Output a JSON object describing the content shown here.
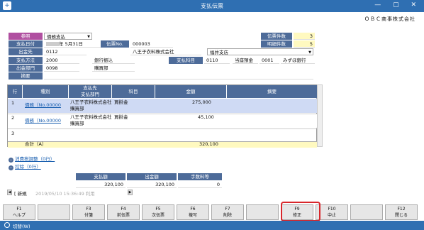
{
  "window": {
    "title": "支払伝票",
    "icon": "+",
    "controls": "— ▢ ✕"
  },
  "company": "ＯＢＣ商事株式会社",
  "header": {
    "ref_label": "参照",
    "ref_value": "債務支払",
    "date_label": "支払日付",
    "date_value": "年  5月31日",
    "slipno_label": "伝票No.",
    "slipno_value": "000003",
    "payee_label": "出金先",
    "payee_code": "0112",
    "payee_name": "八王子衣料株式会社",
    "payee_branch": "福井支店",
    "method_label": "支払方法",
    "method_code": "2000",
    "method_name": "銀行振込",
    "account_label": "支払科目",
    "account_code": "0110",
    "account_name": "当座預金",
    "account_code2": "0001",
    "account_bank": "みずほ銀行",
    "dept_label": "出金部門",
    "dept_code": "0098",
    "dept_name": "購買部",
    "memo_label": "摘要",
    "count_label": "伝票件数",
    "count_value": "3",
    "detail_label": "明細件数",
    "detail_value": "5"
  },
  "grid": {
    "headers": {
      "row": "行",
      "kind": "種別",
      "payee": "支払先",
      "dept": "支払部門",
      "subject": "科目",
      "amount": "金額",
      "memo": "摘要"
    },
    "rows": [
      {
        "no": "1",
        "kind": "債務（No.00000",
        "payee": "八王子衣料株式会社",
        "dept": "購買部",
        "subject": "買掛金",
        "amount": "275,000"
      },
      {
        "no": "2",
        "kind": "債務（No.00000",
        "payee": "八王子衣料株式会社",
        "dept": "購買部",
        "subject": "買掛金",
        "amount": "45,100"
      },
      {
        "no": "3",
        "kind": "",
        "payee": "",
        "dept": "",
        "subject": "",
        "amount": ""
      }
    ],
    "total_label": "合計（A）",
    "total_value": "320,100"
  },
  "links": {
    "tax": "消費税調整（0行）",
    "deduct": "控除（0行）"
  },
  "summary": {
    "h1": "支払額",
    "h2": "出金額",
    "h3": "手数料等",
    "v1": "320,100",
    "v2": "320,100",
    "v3": "0"
  },
  "nav": {
    "mode": "新規",
    "timestamp": "2019/05/10 15:36:49 利用"
  },
  "fkeys": [
    {
      "key": "F1",
      "label": "ヘルプ"
    },
    {
      "key": "",
      "label": ""
    },
    {
      "key": "F3",
      "label": "付箋"
    },
    {
      "key": "F4",
      "label": "前伝票"
    },
    {
      "key": "F5",
      "label": "次伝票"
    },
    {
      "key": "F6",
      "label": "複写"
    },
    {
      "key": "F7",
      "label": "削除"
    },
    {
      "key": "",
      "label": ""
    },
    {
      "key": "F9",
      "label": "修正"
    },
    {
      "key": "F10",
      "label": "中止"
    },
    {
      "key": "",
      "label": ""
    },
    {
      "key": "F12",
      "label": "閉じる"
    }
  ],
  "status": {
    "switch": "切替(W)"
  }
}
